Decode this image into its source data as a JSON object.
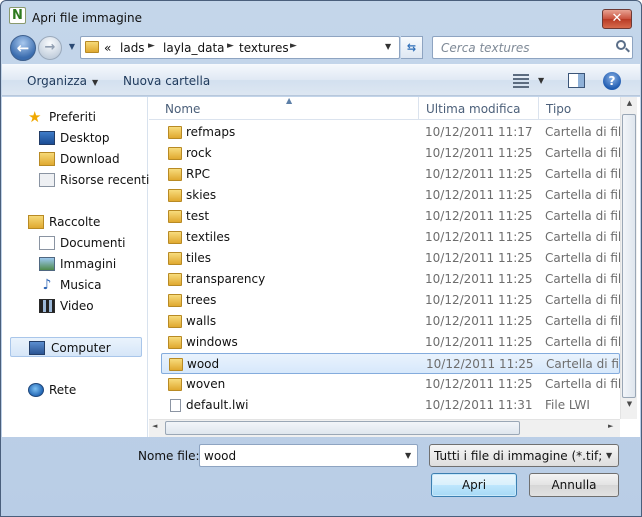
{
  "window": {
    "title": "Apri file immagine",
    "app_icon": "N",
    "close_label": "✕"
  },
  "nav": {
    "back_label": "←",
    "forward_label": "→",
    "address": {
      "overflow": "«",
      "crumbs": [
        "lads",
        "layla_data",
        "textures"
      ],
      "sep": "►"
    },
    "search_placeholder": "Cerca textures"
  },
  "toolbar": {
    "organize": "Organizza",
    "new_folder": "Nuova cartella",
    "help": "?"
  },
  "sidebar": {
    "favorites": {
      "label": "Preferiti",
      "items": [
        "Desktop",
        "Download",
        "Risorse recenti"
      ]
    },
    "libraries": {
      "label": "Raccolte",
      "items": [
        "Documenti",
        "Immagini",
        "Musica",
        "Video"
      ]
    },
    "computer": "Computer",
    "network": "Rete"
  },
  "columns": {
    "name": "Nome",
    "modified": "Ultima modifica",
    "type": "Tipo"
  },
  "files": [
    {
      "name": "refmaps",
      "date": "10/12/2011 11:17",
      "type": "Cartella di file",
      "kind": "folder"
    },
    {
      "name": "rock",
      "date": "10/12/2011 11:25",
      "type": "Cartella di file",
      "kind": "folder"
    },
    {
      "name": "RPC",
      "date": "10/12/2011 11:25",
      "type": "Cartella di file",
      "kind": "folder"
    },
    {
      "name": "skies",
      "date": "10/12/2011 11:25",
      "type": "Cartella di file",
      "kind": "folder"
    },
    {
      "name": "test",
      "date": "10/12/2011 11:25",
      "type": "Cartella di file",
      "kind": "folder"
    },
    {
      "name": "textiles",
      "date": "10/12/2011 11:25",
      "type": "Cartella di file",
      "kind": "folder"
    },
    {
      "name": "tiles",
      "date": "10/12/2011 11:25",
      "type": "Cartella di file",
      "kind": "folder"
    },
    {
      "name": "transparency",
      "date": "10/12/2011 11:25",
      "type": "Cartella di file",
      "kind": "folder"
    },
    {
      "name": "trees",
      "date": "10/12/2011 11:25",
      "type": "Cartella di file",
      "kind": "folder"
    },
    {
      "name": "walls",
      "date": "10/12/2011 11:25",
      "type": "Cartella di file",
      "kind": "folder"
    },
    {
      "name": "windows",
      "date": "10/12/2011 11:25",
      "type": "Cartella di file",
      "kind": "folder"
    },
    {
      "name": "wood",
      "date": "10/12/2011 11:25",
      "type": "Cartella di file",
      "kind": "folder",
      "selected": true
    },
    {
      "name": "woven",
      "date": "10/12/2011 11:25",
      "type": "Cartella di file",
      "kind": "folder"
    },
    {
      "name": "default.lwi",
      "date": "10/12/2011 11:31",
      "type": "File LWI",
      "kind": "file"
    }
  ],
  "bottom": {
    "filename_label": "Nome file:",
    "filename_value": "wood",
    "filter_value": "Tutti i file di immagine (*.tif;*.tga",
    "open_label": "Apri",
    "cancel_label": "Annulla"
  },
  "colors": {
    "accent": "#3c7fb1",
    "selection": "#d7e8fb",
    "titlebar": "#c4d6ea",
    "close": "#c9513d"
  }
}
